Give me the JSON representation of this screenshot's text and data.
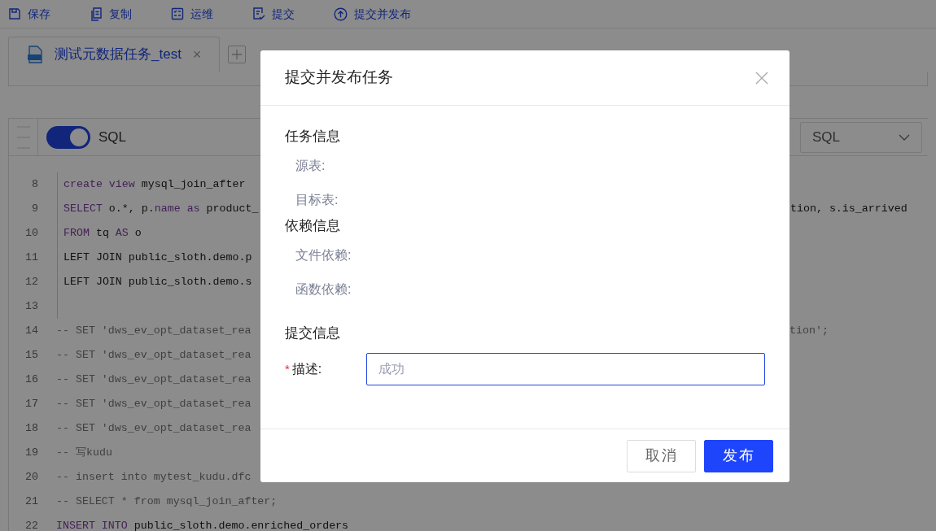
{
  "toolbar": [
    {
      "label": "保存"
    },
    {
      "label": "复制"
    },
    {
      "label": "运维"
    },
    {
      "label": "提交"
    },
    {
      "label": "提交并发布"
    }
  ],
  "tabs": [
    {
      "title": "测试元数据任务_test",
      "selected": true,
      "close": "×"
    }
  ],
  "editor": {
    "mode_toggle": {
      "on": true,
      "label": "SQL"
    },
    "language_select": {
      "value": "SQL"
    },
    "lines": [
      {
        "number": "8",
        "indented": true,
        "left": [
          {
            "kind": "keyword",
            "text": "create view"
          },
          {
            "kind": "plain",
            "text": " mysql_join_after"
          }
        ]
      },
      {
        "number": "9",
        "indented": true,
        "left": [
          {
            "kind": "keyword",
            "text": "SELECT"
          },
          {
            "kind": "plain",
            "text": " o.*, p."
          },
          {
            "kind": "keyword",
            "text": "name"
          },
          {
            "kind": "keyword",
            "text": " as"
          },
          {
            "kind": "plain",
            "text": " product_"
          }
        ],
        "right": [
          {
            "kind": "plain",
            "text": "tion, s.is_arrived"
          }
        ]
      },
      {
        "number": "10",
        "indented": true,
        "left": [
          {
            "kind": "keyword",
            "text": "FROM"
          },
          {
            "kind": "plain",
            "text": " tq "
          },
          {
            "kind": "keyword",
            "text": "AS"
          },
          {
            "kind": "plain",
            "text": " o"
          }
        ]
      },
      {
        "number": "11",
        "indented": true,
        "left": [
          {
            "kind": "plain",
            "text": "LEFT JOIN public_sloth.demo.p"
          }
        ]
      },
      {
        "number": "12",
        "indented": true,
        "left": [
          {
            "kind": "plain",
            "text": "LEFT JOIN public_sloth.demo.s"
          }
        ]
      },
      {
        "number": "13",
        "indented": true
      },
      {
        "number": "14",
        "indented": false,
        "left": [
          {
            "kind": "comment",
            "text": "-- SET 'dws_ev_opt_dataset_rea"
          }
        ],
        "right": [
          {
            "kind": "comment",
            "text": "tion';"
          }
        ]
      },
      {
        "number": "15",
        "indented": false,
        "left": [
          {
            "kind": "comment",
            "text": "-- SET 'dws_ev_opt_dataset_rea"
          }
        ]
      },
      {
        "number": "16",
        "indented": false,
        "left": [
          {
            "kind": "comment",
            "text": "-- SET 'dws_ev_opt_dataset_rea"
          }
        ]
      },
      {
        "number": "17",
        "indented": false,
        "left": [
          {
            "kind": "comment",
            "text": "-- SET 'dws_ev_opt_dataset_rea"
          }
        ]
      },
      {
        "number": "18",
        "indented": false,
        "left": [
          {
            "kind": "comment",
            "text": "-- SET 'dws_ev_opt_dataset_rea"
          }
        ]
      },
      {
        "number": "19",
        "indented": false,
        "left": [
          {
            "kind": "comment",
            "text": "-- 写kudu"
          }
        ]
      },
      {
        "number": "20",
        "indented": false,
        "left": [
          {
            "kind": "comment",
            "text": "-- insert into mytest_kudu.dfc"
          }
        ]
      },
      {
        "number": "21",
        "indented": false,
        "left": [
          {
            "kind": "comment",
            "text": "-- SELECT * from mysql_join_after;"
          }
        ]
      },
      {
        "number": "22",
        "indented": false,
        "left": [
          {
            "kind": "keyword",
            "text": "INSERT INTO"
          },
          {
            "kind": "plain",
            "text": " public_sloth.demo.enriched_orders"
          }
        ]
      }
    ]
  },
  "modal": {
    "title": "提交并发布任务",
    "sections": [
      {
        "title": "任务信息",
        "fields": [
          {
            "label": "源表:"
          },
          {
            "label": "目标表:"
          }
        ]
      },
      {
        "title": "依赖信息",
        "fields": [
          {
            "label": "文件依赖:"
          },
          {
            "label": "函数依赖:"
          }
        ]
      },
      {
        "title": "提交信息",
        "form": {
          "label": "描述:",
          "required_mark": "*",
          "placeholder": "成功"
        }
      }
    ],
    "buttons": [
      {
        "label": "取消",
        "kind": "secondary"
      },
      {
        "label": "发布",
        "kind": "primary"
      }
    ]
  }
}
